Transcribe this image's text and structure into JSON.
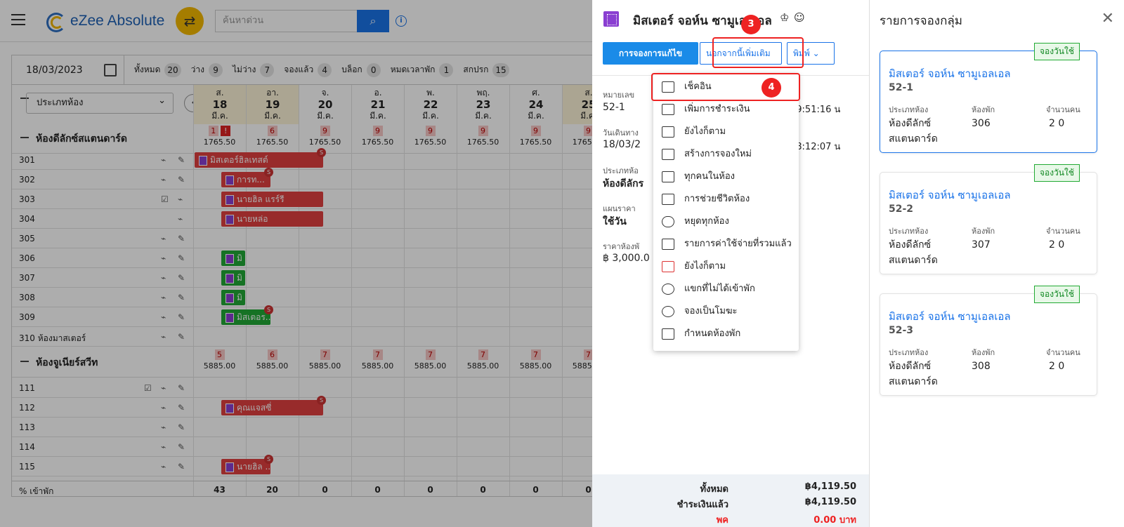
{
  "app": {
    "brand": "eZee Absolute",
    "search_placeholder": "ค้นหาด่วน"
  },
  "calendar": {
    "date": "18/03/2023",
    "filters": [
      {
        "label": "ทั้งหมด",
        "count": "20"
      },
      {
        "label": "ว่าง",
        "count": "9"
      },
      {
        "label": "ไม่ว่าง",
        "count": "7"
      },
      {
        "label": "จองแล้ว",
        "count": "4"
      },
      {
        "label": "บล็อก",
        "count": "0"
      },
      {
        "label": "หมดเวลาพัก",
        "count": "1"
      },
      {
        "label": "สกปรก",
        "count": "15"
      }
    ],
    "room_type_select": "ประเภทห้อง",
    "days": [
      {
        "dow": "ส.",
        "num": "18",
        "mon": "มี.ค."
      },
      {
        "dow": "อา.",
        "num": "19",
        "mon": "มี.ค."
      },
      {
        "dow": "จ.",
        "num": "20",
        "mon": "มี.ค."
      },
      {
        "dow": "อ.",
        "num": "21",
        "mon": "มี.ค."
      },
      {
        "dow": "พ.",
        "num": "22",
        "mon": "มี.ค."
      },
      {
        "dow": "พฤ.",
        "num": "23",
        "mon": "มี.ค."
      },
      {
        "dow": "ศ.",
        "num": "24",
        "mon": "มี.ค."
      },
      {
        "dow": "ส.",
        "num": "25",
        "mon": "มี.ค."
      }
    ],
    "group1": {
      "name": "ห้องดีลักซ์สแตนดาร์ด",
      "counts": [
        "1",
        "6",
        "9",
        "9",
        "9",
        "9",
        "9",
        "9"
      ],
      "alert": "!",
      "prices": [
        "1765.50",
        "1765.50",
        "1765.50",
        "1765.50",
        "1765.50",
        "1765.50",
        "1765.50",
        "1765.50"
      ]
    },
    "rooms1": [
      "301",
      "302",
      "303",
      "304",
      "305",
      "306",
      "307",
      "308",
      "309",
      "310 ห้องมาสเตอร์"
    ],
    "group2": {
      "name": "ห้องจูเนียร์สวีท",
      "counts": [
        "5",
        "6",
        "7",
        "7",
        "7",
        "7",
        "7",
        "7"
      ],
      "prices": [
        "5885.00",
        "5885.00",
        "5885.00",
        "5885.00",
        "5885.00",
        "5885.00",
        "5885.00",
        "5885.00"
      ]
    },
    "rooms2": [
      "111",
      "112",
      "113",
      "114",
      "115"
    ],
    "bookings": [
      "มิสเตอร์ฮิลเทสต์",
      "การท...",
      "นายฮิล แรร์รี",
      "นายหล่อ",
      "มิ",
      "มิ",
      "มิ",
      "มิสเตอร...",
      "คุณแจสซี่",
      "นายฮิล ..."
    ],
    "badges": {
      "s": "S"
    },
    "footer": {
      "label": "% เข้าพัก",
      "values": [
        "43",
        "20",
        "0",
        "0",
        "0",
        "0",
        "0",
        "0"
      ]
    }
  },
  "detail": {
    "title": "มิสเตอร์ จอห์น ซามูเอลเอล",
    "btn_edit": "การจองการแก้ไข",
    "btn_more": "นอกจากนี้เพิ่มเติม",
    "btn_print": "พิมพ์",
    "fields": [
      {
        "label": "หมายเลข",
        "value": "52-1",
        "extra": "09:51:16 น"
      },
      {
        "label": "วันเดินทาง",
        "value": "18/03/2",
        "extra": "08:12:07 น"
      },
      {
        "label": "ประเภทห้อ",
        "value": "ห้องดีลักร"
      },
      {
        "label": "แผนราคา",
        "value": "ใช้วัน"
      },
      {
        "label": "ราคาห้องพั",
        "value": "฿ 3,000.0"
      }
    ],
    "totals": [
      {
        "label": "ทั้งหมด",
        "value": "฿4,119.50"
      },
      {
        "label": "ชำระเงินแล้ว",
        "value": "฿4,119.50"
      },
      {
        "label": "พค",
        "value": "0.00 บาท"
      }
    ]
  },
  "steps": {
    "s3": "3",
    "s4": "4"
  },
  "menu": [
    "เช็คอิน",
    "เพิ่มการชำระเงิน",
    "ยังไงก็ตาม",
    "สร้างการจองใหม่",
    "ทุกคนในห้อง",
    "การช่วยชีวิตห้อง",
    "หยุดทุกห้อง",
    "รายการค่าใช้จ่ายที่รวมแล้ว",
    "ยังไงก็ตาม",
    "แขกที่ไม่ได้เข้าพัก",
    "จองเป็นโมฆะ",
    "กำหนดห้องพัก"
  ],
  "group_panel": {
    "title": "รายการจองกลุ่ม",
    "cards": [
      {
        "tag": "จองวันใช้",
        "name": "มิสเตอร์ จอห์น ซามูเอลเอล",
        "code": "52-1",
        "l1": "ประเภทห้อง",
        "l2": "ห้องพัก",
        "l3": "จำนวนคน",
        "room_type": "ห้องดีลักซ์ สแตนดาร์ด",
        "room": "306",
        "pax": "2 0"
      },
      {
        "tag": "จองวันใช้",
        "name": "มิสเตอร์ จอห์น ซามูเอลเอล",
        "code": "52-2",
        "l1": "ประเภทห้อง",
        "l2": "ห้องพัก",
        "l3": "จำนวนคน",
        "room_type": "ห้องดีลักซ์ สแตนดาร์ด",
        "room": "307",
        "pax": "2 0"
      },
      {
        "tag": "จองวันใช้",
        "name": "มิสเตอร์ จอห์น ซามูเอลเอล",
        "code": "52-3",
        "l1": "ประเภทห้อง",
        "l2": "ห้องพัก",
        "l3": "จำนวนคน",
        "room_type": "ห้องดีลักซ์ สแตนดาร์ด",
        "room": "308",
        "pax": "2 0"
      }
    ]
  }
}
